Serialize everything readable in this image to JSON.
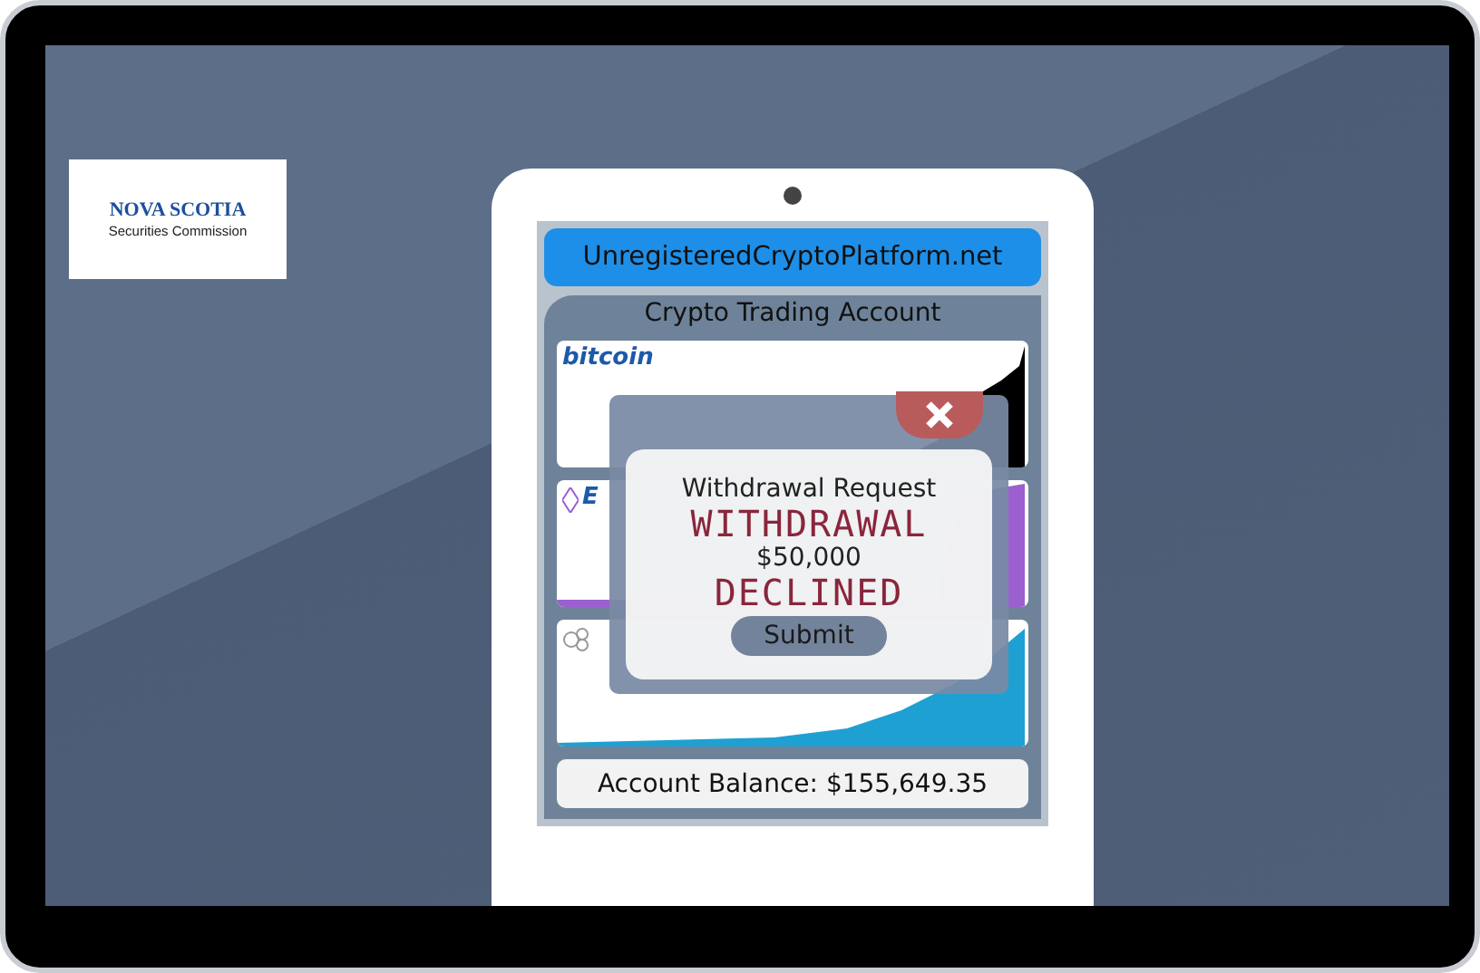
{
  "logo": {
    "name": "NOVA SCOTIA",
    "subtitle": "Securities Commission"
  },
  "tablet": {
    "url": "UnregisteredCryptoPlatform.net",
    "account_title": "Crypto Trading Account",
    "coins": [
      {
        "kind": "bitcoin",
        "label": "bitcoin",
        "color": "#000000"
      },
      {
        "kind": "ethereum",
        "label": "E",
        "color": "#9b5fcf"
      },
      {
        "kind": "ripple",
        "color": "#1ea0d2"
      }
    ],
    "balance": "Account Balance: $155,649.35"
  },
  "dialog": {
    "title": "Withdrawal Request",
    "amount": "$50,000",
    "button": "Submit",
    "stamp": [
      "WITHDRAWAL",
      "DECLINED"
    ]
  }
}
